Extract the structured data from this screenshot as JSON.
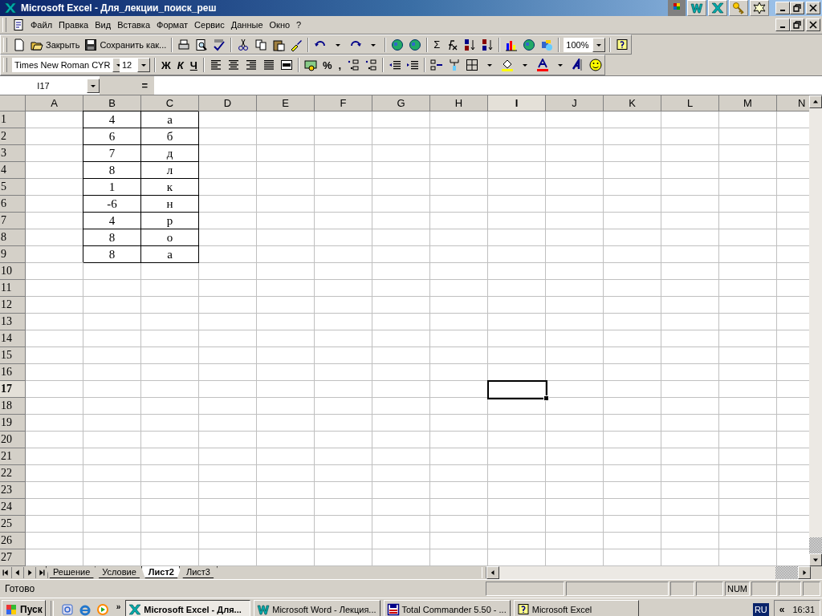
{
  "window": {
    "title": "Microsoft Excel - Для_лекции_поиск_реш"
  },
  "menu": [
    "Файл",
    "Правка",
    "Вид",
    "Вставка",
    "Формат",
    "Сервис",
    "Данные",
    "Окно",
    "?"
  ],
  "standard_toolbar": {
    "close_label": "Закрыть",
    "save_as_label": "Сохранить как...",
    "autosum": "Σ",
    "zoom": "100%"
  },
  "formatting_toolbar": {
    "font": "Times New Roman CYR",
    "size": "12",
    "bold": "Ж",
    "italic": "К",
    "underline": "Ч",
    "percent": "%",
    "comma": ","
  },
  "formula_bar": {
    "name_box": "I17",
    "equals": "="
  },
  "sheet": {
    "columns": [
      {
        "label": "A",
        "selected": false
      },
      {
        "label": "B",
        "selected": false,
        "cells": [
          "4",
          "6",
          "7",
          "8",
          "1",
          "-6",
          "4",
          "8",
          "8"
        ]
      },
      {
        "label": "C",
        "selected": false,
        "cells": [
          "а",
          "б",
          "д",
          "л",
          "к",
          "н",
          "р",
          "о",
          "а"
        ]
      },
      {
        "label": "D",
        "selected": false
      },
      {
        "label": "E",
        "selected": false
      },
      {
        "label": "F",
        "selected": false
      },
      {
        "label": "G",
        "selected": false
      },
      {
        "label": "H",
        "selected": false
      },
      {
        "label": "I",
        "selected": true
      },
      {
        "label": "J",
        "selected": false
      },
      {
        "label": "K",
        "selected": false
      },
      {
        "label": "L",
        "selected": false
      },
      {
        "label": "M",
        "selected": false
      },
      {
        "label": "N",
        "selected": false
      }
    ],
    "rows": [
      {
        "label": "1",
        "selected": false
      },
      {
        "label": "2",
        "selected": false
      },
      {
        "label": "3",
        "selected": false
      },
      {
        "label": "4",
        "selected": false
      },
      {
        "label": "5",
        "selected": false
      },
      {
        "label": "6",
        "selected": false
      },
      {
        "label": "7",
        "selected": false
      },
      {
        "label": "8",
        "selected": false
      },
      {
        "label": "9",
        "selected": false
      },
      {
        "label": "10",
        "selected": false
      },
      {
        "label": "11",
        "selected": false
      },
      {
        "label": "12",
        "selected": false
      },
      {
        "label": "13",
        "selected": false
      },
      {
        "label": "14",
        "selected": false
      },
      {
        "label": "15",
        "selected": false
      },
      {
        "label": "16",
        "selected": false
      },
      {
        "label": "17",
        "selected": true
      },
      {
        "label": "18",
        "selected": false
      },
      {
        "label": "19",
        "selected": false
      },
      {
        "label": "20",
        "selected": false
      },
      {
        "label": "21",
        "selected": false
      },
      {
        "label": "22",
        "selected": false
      },
      {
        "label": "23",
        "selected": false
      },
      {
        "label": "24",
        "selected": false
      },
      {
        "label": "25",
        "selected": false
      },
      {
        "label": "26",
        "selected": false
      },
      {
        "label": "27",
        "selected": false
      }
    ]
  },
  "sheet_tabs": [
    {
      "label": "Решение",
      "selected": false
    },
    {
      "label": "Условие",
      "selected": false
    },
    {
      "label": "Лист2",
      "selected": true
    },
    {
      "label": "Лист3",
      "selected": false
    }
  ],
  "status_bar": {
    "text": "Готово",
    "indicator": "NUM"
  },
  "taskbar": {
    "start": "Пуск",
    "quick_launch_more": "»",
    "tasks": [
      {
        "label": "Microsoft Excel - Для...",
        "selected": true
      },
      {
        "label": "Microsoft Word - Лекция...",
        "selected": false
      },
      {
        "label": "Total Commander 5.50 - ...",
        "selected": false
      },
      {
        "label": "Microsoft Excel",
        "selected": false
      }
    ],
    "language": "RU",
    "tray_toggle": "«",
    "clock": "16:31"
  }
}
